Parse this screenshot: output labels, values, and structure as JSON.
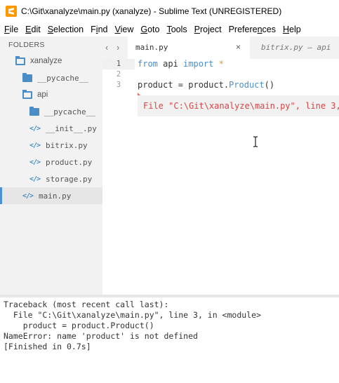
{
  "titlebar": {
    "title": "C:\\Git\\xanalyze\\main.py (xanalyze) - Sublime Text (UNREGISTERED)",
    "app_icon": "sublime-text-logo"
  },
  "menubar": {
    "items": [
      {
        "label": "File",
        "access": "F"
      },
      {
        "label": "Edit",
        "access": "E"
      },
      {
        "label": "Selection",
        "access": "S"
      },
      {
        "label": "Find",
        "access": "i"
      },
      {
        "label": "View",
        "access": "V"
      },
      {
        "label": "Goto",
        "access": "G"
      },
      {
        "label": "Tools",
        "access": "T"
      },
      {
        "label": "Project",
        "access": "P"
      },
      {
        "label": "Preferences",
        "access": "n"
      },
      {
        "label": "Help",
        "access": "H"
      }
    ]
  },
  "sidebar": {
    "header": "FOLDERS",
    "items": [
      {
        "label": "xanalyze",
        "icon": "folder-open-icon"
      },
      {
        "label": "__pycache__",
        "icon": "folder-icon"
      },
      {
        "label": "api",
        "icon": "folder-open-icon"
      },
      {
        "label": "__pycache__",
        "icon": "folder-icon"
      },
      {
        "label": "__init__.py",
        "icon": "code-file-icon"
      },
      {
        "label": "bitrix.py",
        "icon": "code-file-icon"
      },
      {
        "label": "product.py",
        "icon": "code-file-icon"
      },
      {
        "label": "storage.py",
        "icon": "code-file-icon"
      },
      {
        "label": "main.py",
        "icon": "code-file-icon",
        "selected": true
      }
    ]
  },
  "tabs": {
    "nav_left": "‹",
    "nav_right": "›",
    "active": {
      "label": "main.py",
      "close": "×"
    },
    "inactive": {
      "label": "bitrix.py — api"
    }
  },
  "editor": {
    "line_numbers": [
      "1",
      "2",
      "3"
    ],
    "active_line": "1",
    "lines": {
      "l1": {
        "kw_from": "from",
        "module": " api ",
        "kw_import": "import",
        "star": " *"
      },
      "l3": {
        "lhs": "product = product.",
        "call": "Product",
        "args": "()"
      }
    },
    "phantom_error": "File \"C:\\Git\\xanalyze\\main.py\", line 3,"
  },
  "output": {
    "lines": [
      "Traceback (most recent call last):",
      "  File \"C:\\Git\\xanalyze\\main.py\", line 3, in <module>",
      "    product = product.Product()",
      "NameError: name 'product' is not defined",
      "[Finished in 0.7s]"
    ]
  },
  "colors": {
    "accent": "#4b8ec7",
    "error": "#d64545",
    "sidebar_bg": "#f2f2f2",
    "app_icon": "#ff9800"
  }
}
